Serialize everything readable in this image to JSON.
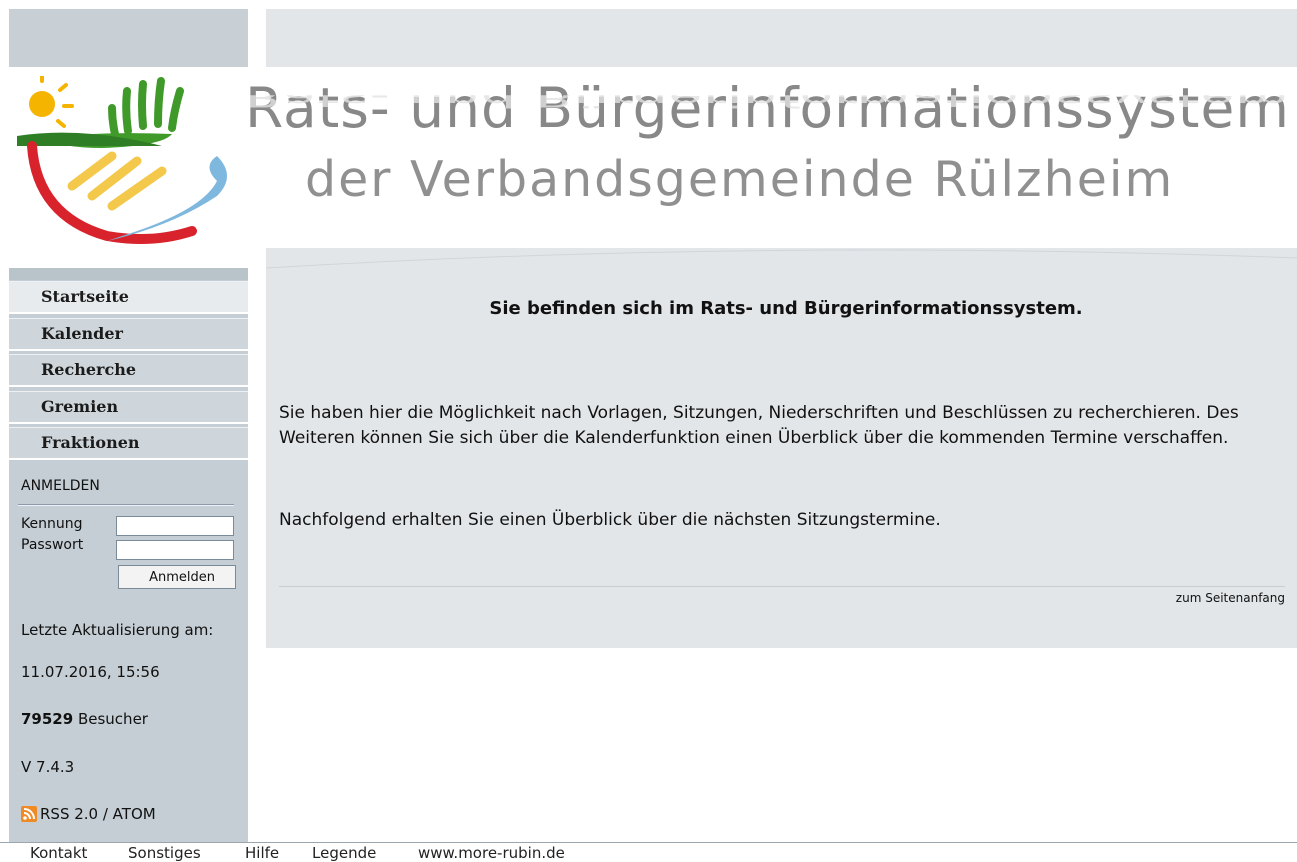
{
  "header": {
    "title_line1": "Rats- und Bürgerinformationssystem",
    "title_line2": "der Verbandsgemeinde Rülzheim"
  },
  "nav": {
    "items": [
      {
        "label": "Startseite"
      },
      {
        "label": "Kalender"
      },
      {
        "label": "Recherche"
      },
      {
        "label": "Gremien"
      },
      {
        "label": "Fraktionen"
      }
    ]
  },
  "login": {
    "title": "ANMELDEN",
    "username_label": "Kennung",
    "password_label": "Passwort",
    "username_value": "",
    "password_value": "",
    "button_label": "Anmelden"
  },
  "sidebar_info": {
    "update_label": "Letzte Aktualisierung am:",
    "update_date": "11.07.2016, 15:56",
    "visitor_count": "79529",
    "visitor_label": "Besucher",
    "version": "V 7.4.3",
    "rss_label": "RSS 2.0 / ATOM"
  },
  "main": {
    "welcome": "Sie befinden sich im Rats- und Bürgerinformationssystem.",
    "paragraph1": "Sie haben hier die Möglichkeit nach Vorlagen, Sitzungen, Niederschriften und Beschlüssen zu recherchieren. Des Weiteren können Sie sich über die Kalenderfunktion einen Überblick über die kommenden Termine verschaffen.",
    "paragraph2": "Nachfolgend erhalten Sie einen Überblick über die nächsten Sitzungstermine.",
    "to_top": "zum Seitenanfang"
  },
  "footer": {
    "links": [
      "Kontakt",
      "Sonstiges",
      "Hilfe",
      "Legende",
      "www.more-rubin.de"
    ]
  },
  "colors": {
    "sidebar": "#c5ced4",
    "content_bg": "#e3e6e9",
    "title_gray": "#888888"
  }
}
